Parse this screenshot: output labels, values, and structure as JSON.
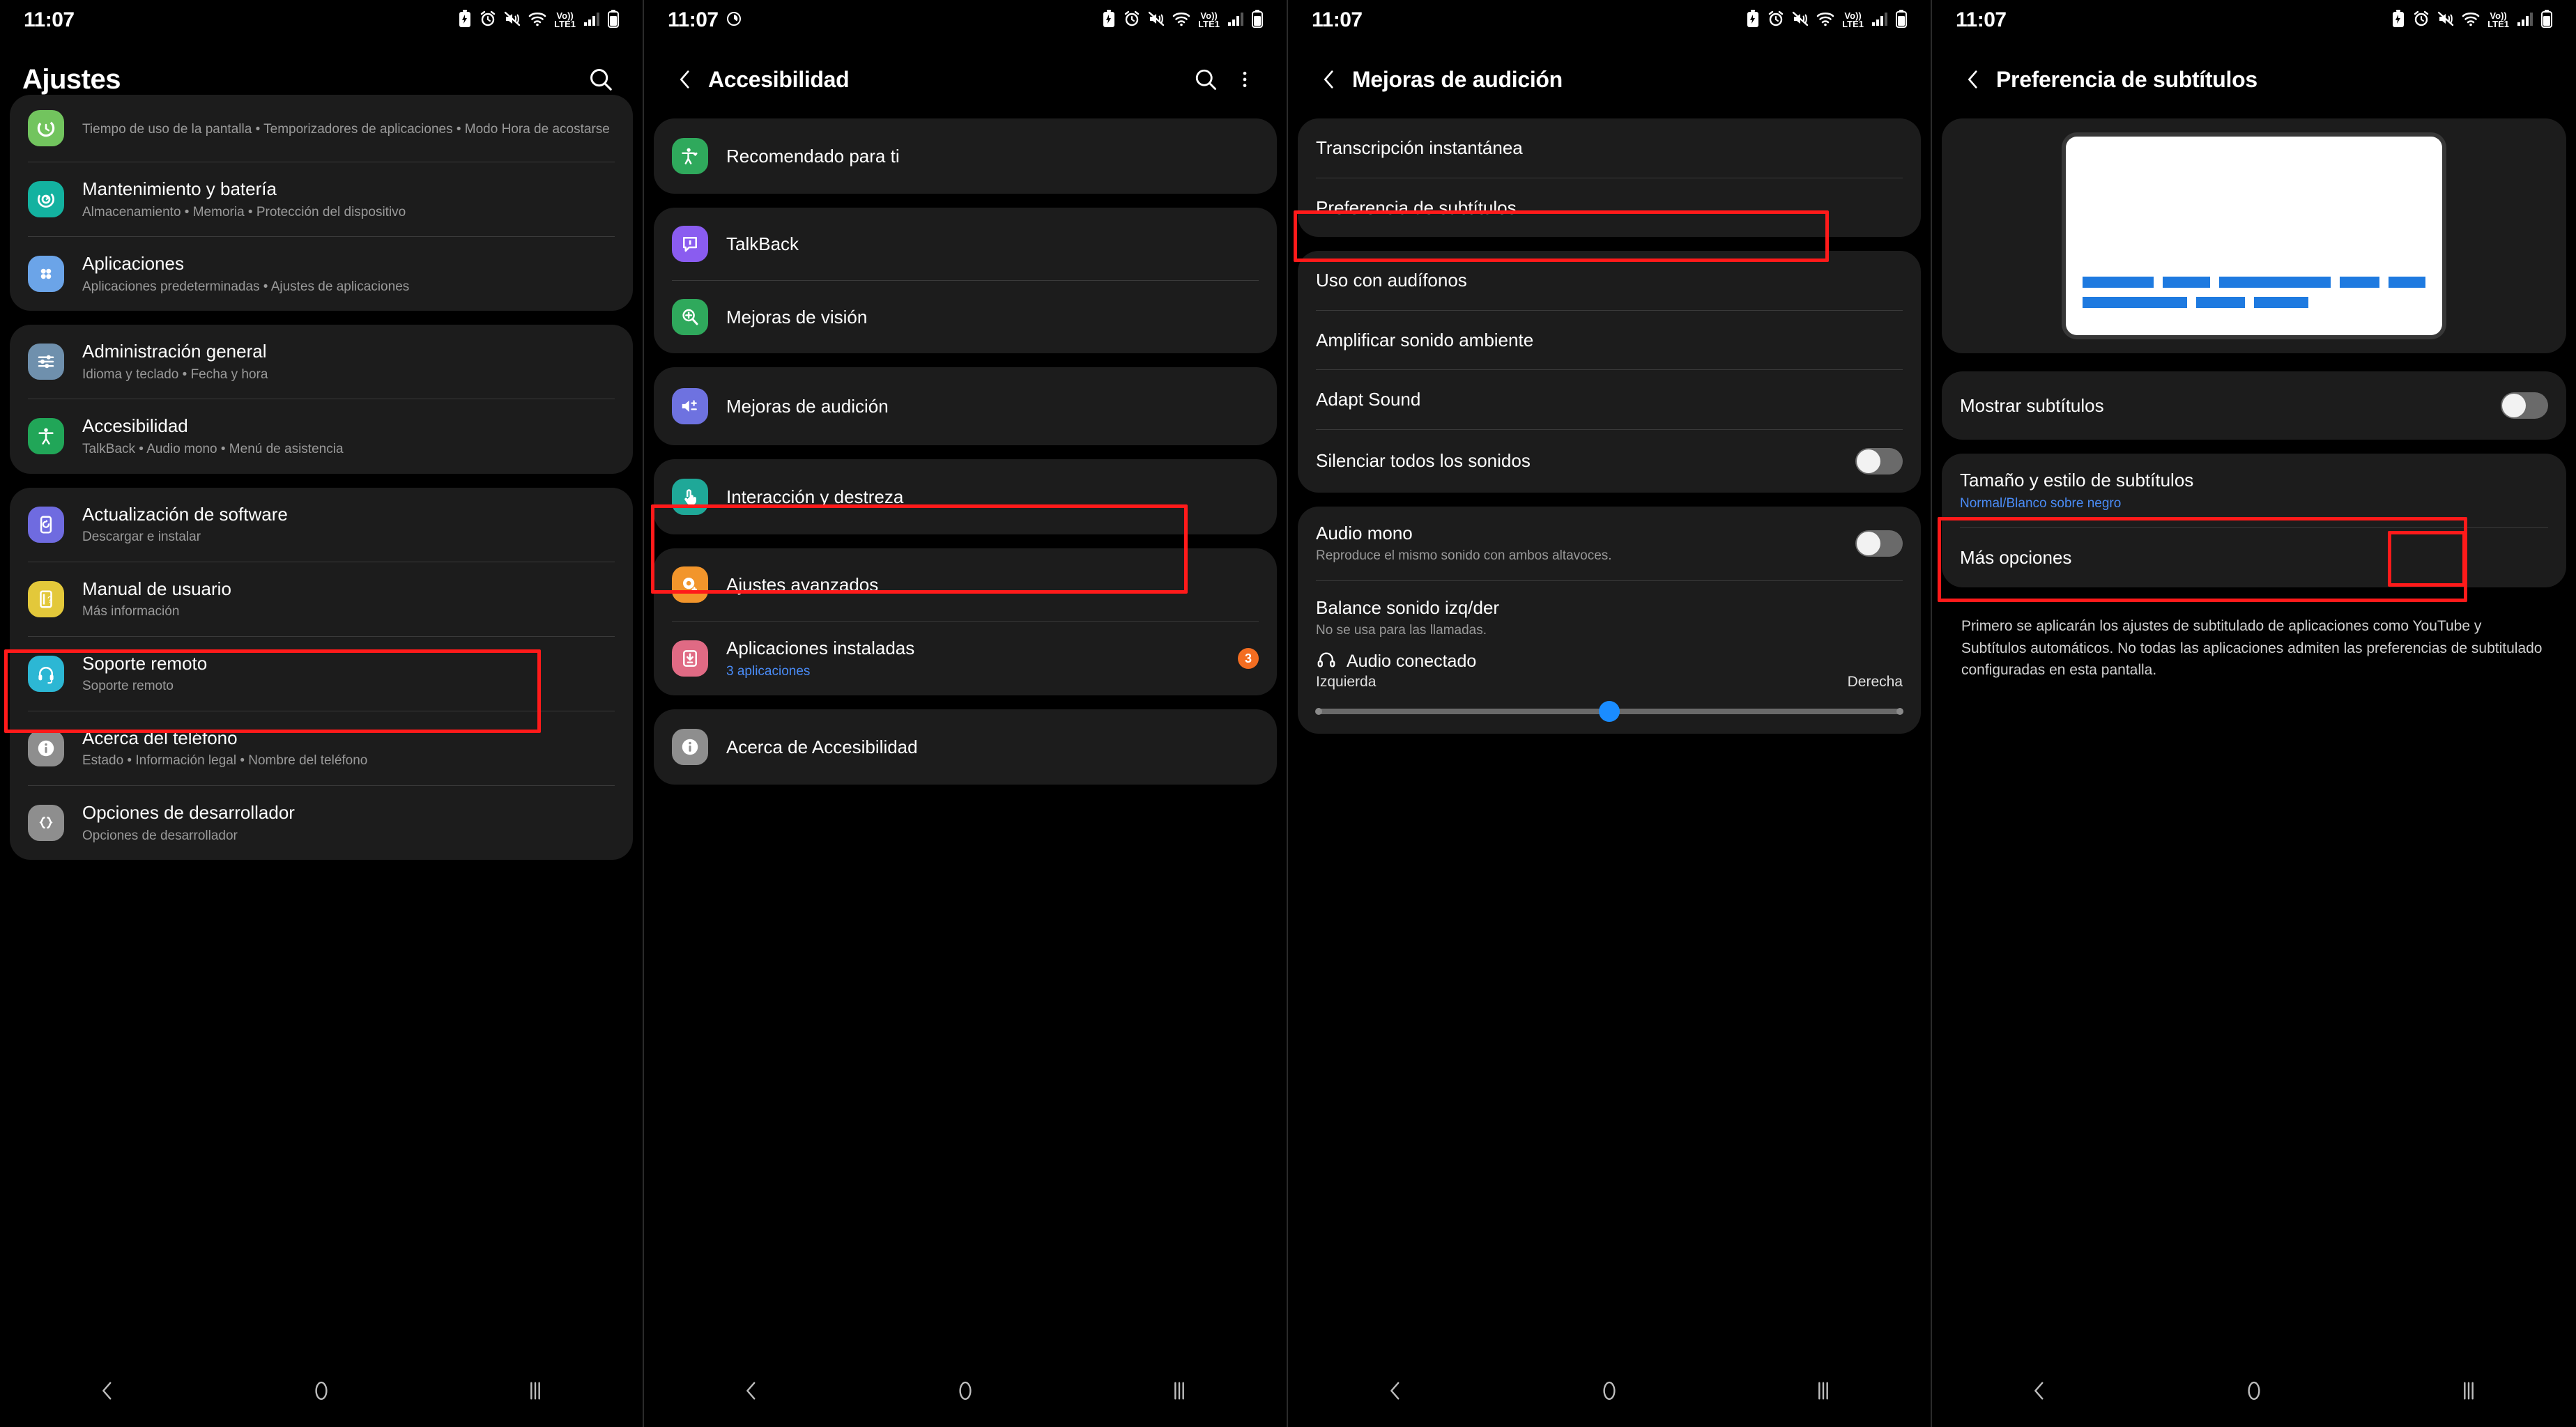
{
  "status_bar": {
    "time": "11:07",
    "clock_glyph": "◔",
    "icons": [
      "battery-saver-icon",
      "alarm-icon",
      "mute-vibrate-icon",
      "wifi-icon",
      "volte-icon",
      "signal-bars-icon",
      "battery-icon"
    ],
    "volte_top": "Vo))",
    "volte_bottom": "LTE1"
  },
  "nav_bar": {
    "back": "back-nav",
    "home": "home-nav",
    "recents": "recents-nav"
  },
  "screen1": {
    "title": "Ajustes",
    "search_icon": "search-icon",
    "groups": [
      {
        "items": [
          {
            "icon": "digital-wellbeing-icon",
            "icon_color": "#72c45e",
            "title": "",
            "sub": "Tiempo de uso de la pantalla • Temporizadores de aplicaciones • Modo Hora de acostarse"
          },
          {
            "icon": "device-care-icon",
            "icon_color": "#13b2a0",
            "title": "Mantenimiento y batería",
            "sub": "Almacenamiento • Memoria • Protección del dispositivo"
          },
          {
            "icon": "apps-icon",
            "icon_color": "#6ba4e8",
            "title": "Aplicaciones",
            "sub": "Aplicaciones predeterminadas • Ajustes de aplicaciones"
          }
        ]
      },
      {
        "items": [
          {
            "icon": "sliders-icon",
            "icon_color": "#6f90ad",
            "title": "Administración general",
            "sub": "Idioma y teclado • Fecha y hora"
          },
          {
            "icon": "accessibility-icon",
            "icon_color": "#21a658",
            "title": "Accesibilidad",
            "sub": "TalkBack • Audio mono • Menú de asistencia",
            "highlighted": true
          }
        ]
      },
      {
        "items": [
          {
            "icon": "software-update-icon",
            "icon_color": "#6f6be0",
            "title": "Actualización de software",
            "sub": "Descargar e instalar"
          },
          {
            "icon": "user-manual-icon",
            "icon_color": "#e3c83a",
            "title": "Manual de usuario",
            "sub": "Más información"
          },
          {
            "icon": "remote-support-icon",
            "icon_color": "#2cb7d4",
            "title": "Soporte remoto",
            "sub": "Soporte remoto"
          },
          {
            "icon": "about-phone-icon",
            "icon_color": "#8e8e8e",
            "title": "Acerca del teléfono",
            "sub": "Estado • Información legal • Nombre del teléfono"
          },
          {
            "icon": "developer-options-icon",
            "icon_color": "#8e8e8e",
            "title": "Opciones de desarrollador",
            "sub": "Opciones de desarrollador"
          }
        ]
      }
    ]
  },
  "screen2": {
    "title": "Accesibilidad",
    "back_icon": "back-chevron-icon",
    "search_icon": "search-icon",
    "more_icon": "overflow-menu-icon",
    "groups": [
      {
        "items": [
          {
            "icon": "recommended-icon",
            "icon_color": "#2fa95c",
            "title": "Recomendado para ti"
          }
        ]
      },
      {
        "items": [
          {
            "icon": "talkback-icon",
            "icon_color": "#8a5cf0",
            "title": "TalkBack"
          },
          {
            "icon": "vision-icon",
            "icon_color": "#2fa95c",
            "title": "Mejoras de visión"
          }
        ]
      },
      {
        "items": [
          {
            "icon": "hearing-icon",
            "icon_color": "#6e72e0",
            "title": "Mejoras de audición",
            "highlighted": true
          }
        ]
      },
      {
        "items": [
          {
            "icon": "interaction-icon",
            "icon_color": "#1fa898",
            "title": "Interacción y destreza"
          }
        ]
      },
      {
        "items": [
          {
            "icon": "advanced-settings-icon",
            "icon_color": "#f2952b",
            "title": "Ajustes avanzados"
          },
          {
            "icon": "installed-apps-icon",
            "icon_color": "#e06a84",
            "title": "Aplicaciones instaladas",
            "sub": "3 aplicaciones",
            "sub_blue": true,
            "badge": "3"
          }
        ]
      },
      {
        "items": [
          {
            "icon": "info-icon",
            "icon_color": "#8e8e8e",
            "title": "Acerca de Accesibilidad"
          }
        ]
      }
    ]
  },
  "screen3": {
    "title": "Mejoras de audición",
    "back_icon": "back-chevron-icon",
    "groups": [
      {
        "items": [
          {
            "title": "Transcripción instantánea"
          },
          {
            "title": "Preferencia de subtítulos",
            "highlighted": true
          }
        ]
      },
      {
        "items": [
          {
            "title": "Uso con audífonos"
          },
          {
            "title": "Amplificar sonido ambiente"
          },
          {
            "title": "Adapt Sound"
          },
          {
            "title": "Silenciar todos los sonidos",
            "toggle": "off"
          }
        ]
      }
    ],
    "mono": {
      "title": "Audio mono",
      "sub": "Reproduce el mismo sonido con ambos altavoces.",
      "toggle": "off"
    },
    "balance": {
      "title": "Balance sonido izq/der",
      "sub": "No se usa para las llamadas.",
      "connected_icon": "headphones-icon",
      "connected_label": "Audio conectado",
      "left_label": "Izquierda",
      "right_label": "Derecha",
      "value_percent": 50
    }
  },
  "screen4": {
    "title": "Preferencia de subtítulos",
    "back_icon": "back-chevron-icon",
    "preview": {
      "caption_color": "#1e7ae0",
      "background_color": "#ffffff",
      "line1_widths": [
        128,
        84,
        200,
        72,
        66
      ],
      "line2_widths": [
        150,
        70,
        78
      ]
    },
    "show_captions": {
      "title": "Mostrar subtítulos",
      "toggle": "off",
      "highlighted": true
    },
    "items": [
      {
        "title": "Tamaño y estilo de subtítulos",
        "sub": "Normal/Blanco sobre negro",
        "sub_blue": true
      },
      {
        "title": "Más opciones"
      }
    ],
    "description": "Primero se aplicarán los ajustes de subtitulado de aplicaciones como YouTube y Subtítulos automáticos. No todas las aplicaciones admiten las preferencias de subtitulado configuradas en esta pantalla."
  },
  "colors": {
    "highlight": "#ff1a1a",
    "accent_blue": "#4a8cf7",
    "toggle_on": "#1a73e8",
    "slider": "#1a8cff"
  }
}
